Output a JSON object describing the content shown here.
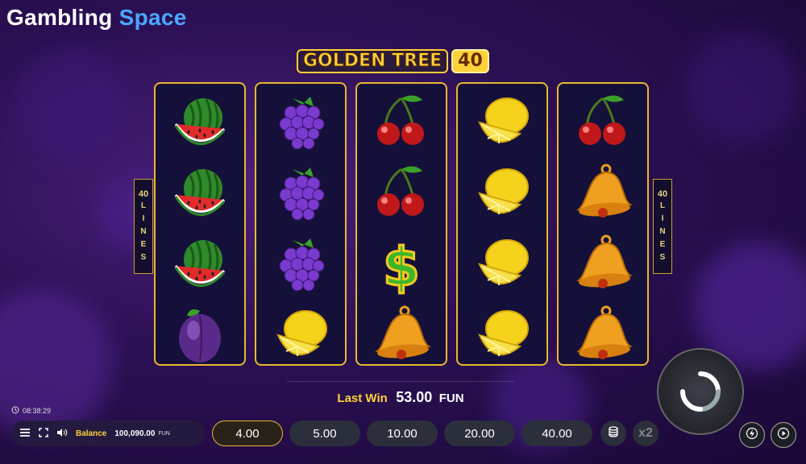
{
  "brand": {
    "part1": "Gambling",
    "part2": "Space"
  },
  "game_title": {
    "main": "GOLDEN TREE",
    "badge": "40"
  },
  "paylines": {
    "number": "40",
    "word": [
      "L",
      "I",
      "N",
      "E",
      "S"
    ]
  },
  "reels": [
    [
      "watermelon-icon",
      "watermelon-icon",
      "watermelon-icon",
      "plum-icon"
    ],
    [
      "grapes-icon",
      "grapes-icon",
      "grapes-icon",
      "lemon-icon"
    ],
    [
      "cherry-icon",
      "cherry-icon",
      "dollar-icon",
      "bell-icon"
    ],
    [
      "lemon-icon",
      "lemon-icon",
      "lemon-icon",
      "lemon-icon"
    ],
    [
      "cherry-icon",
      "bell-icon",
      "bell-icon",
      "bell-icon"
    ]
  ],
  "last_win": {
    "label": "Last Win",
    "value": "53.00",
    "currency": "FUN"
  },
  "clock": "08:38:29",
  "balance": {
    "label": "Balance",
    "value": "100,090.00",
    "currency": "FUN"
  },
  "bets": [
    "4.00",
    "5.00",
    "10.00",
    "20.00",
    "40.00"
  ],
  "selected_bet": "4.00",
  "multiplier_label": "x2",
  "colors": {
    "accent": "#e8b830",
    "title_gold": "#ffd23a",
    "bg": "#2a0f52",
    "brand_blue": "#4aa8ff"
  }
}
